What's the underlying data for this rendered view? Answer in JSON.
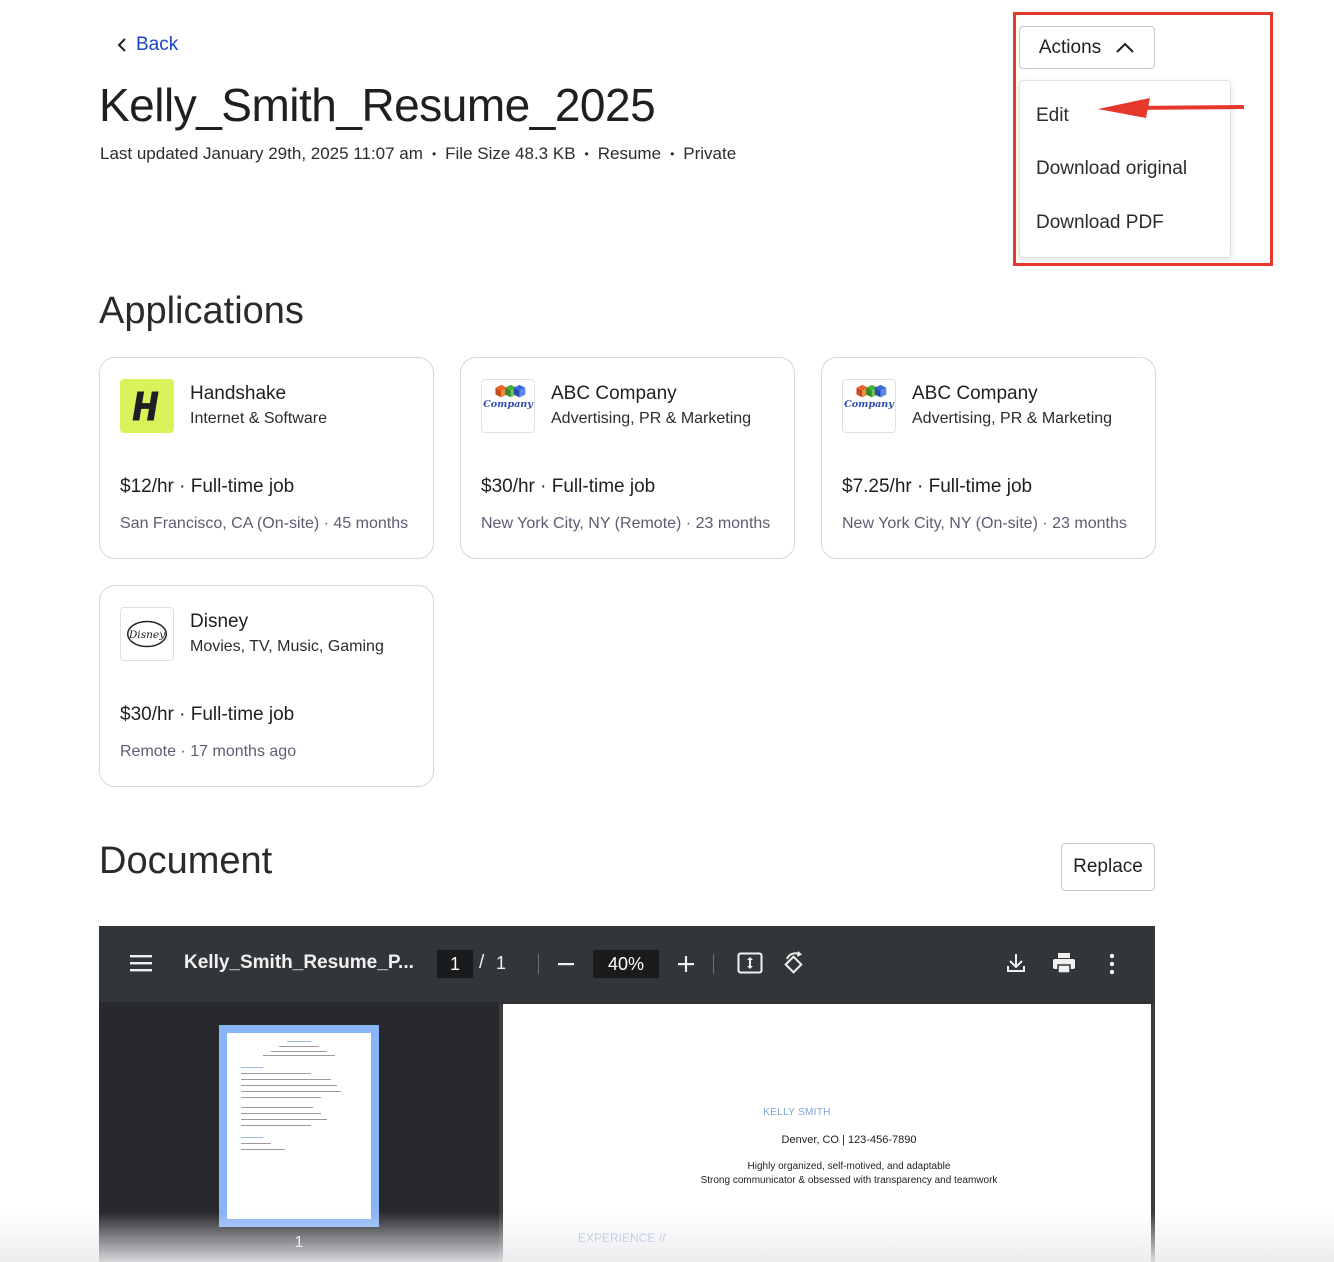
{
  "header": {
    "back_label": "Back",
    "title": "Kelly_Smith_Resume_2025",
    "meta": {
      "updated": "Last updated January 29th, 2025 11:07 am",
      "file_size": "File Size 48.3 KB",
      "type": "Resume",
      "visibility": "Private",
      "separator": "•"
    }
  },
  "actions": {
    "button_label": "Actions",
    "menu": [
      "Edit",
      "Download original",
      "Download PDF"
    ]
  },
  "annotation": {
    "highlight_color": "#e5372b"
  },
  "applications": {
    "title": "Applications",
    "cards": [
      {
        "name": "Handshake",
        "industry": "Internet & Software",
        "pay": "$12/hr · Full-time job",
        "location": "San Francisco, CA (On-site) · 45 months",
        "logo": "handshake-logo"
      },
      {
        "name": "ABC Company",
        "industry": "Advertising, PR & Marketing",
        "pay": "$30/hr · Full-time job",
        "location": "New York City, NY (Remote) · 23 months",
        "logo": "abc-company-logo"
      },
      {
        "name": "ABC Company",
        "industry": "Advertising, PR & Marketing",
        "pay": "$7.25/hr · Full-time job",
        "location": "New York City, NY (On-site) · 23 months",
        "logo": "abc-company-logo"
      },
      {
        "name": "Disney",
        "industry": "Movies, TV, Music, Gaming",
        "pay": "$30/hr · Full-time job",
        "location": "Remote · 17 months ago",
        "logo": "disney-logo"
      }
    ]
  },
  "document": {
    "title": "Document",
    "replace_label": "Replace"
  },
  "viewer": {
    "filename": "Kelly_Smith_Resume_P...",
    "current_page": "1",
    "page_separator": "/",
    "total_pages": "1",
    "zoom": "40%",
    "thumbnail_label": "1",
    "resume": {
      "name": "KELLY SMITH",
      "contact": "Denver, CO | 123-456-7890",
      "summary_line1": "Highly organized, self-motived, and adaptable",
      "summary_line2": "Strong communicator & obsessed with transparency and teamwork",
      "section": "EXPERIENCE //"
    }
  },
  "colors": {
    "link": "#1a44c8",
    "viewer_toolbar": "#323639",
    "viewer_bg": "#3c3e42",
    "thumb_selected": "#8ab4f8",
    "handshake_green": "#d8f35a"
  }
}
